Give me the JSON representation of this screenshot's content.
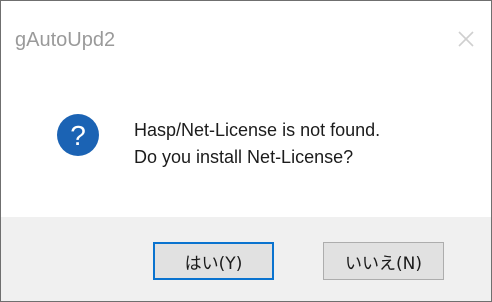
{
  "window": {
    "title": "gAutoUpd2",
    "close_icon": "close-icon"
  },
  "message": {
    "icon": "question-icon",
    "line1": "Hasp/Net-License is not found.",
    "line2": "Do you install Net-License?"
  },
  "buttons": {
    "yes_label": "はい(Y)",
    "no_label": "いいえ(N)"
  },
  "colors": {
    "icon_blue": "#1b63b4",
    "default_button_border": "#0a73cf",
    "footer_bg": "#f0f0f0"
  }
}
